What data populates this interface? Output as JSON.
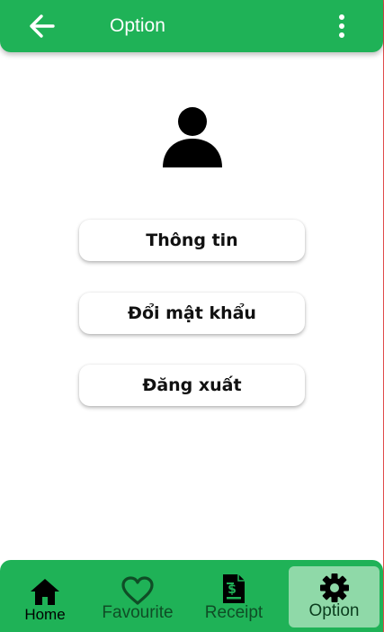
{
  "app_bar": {
    "title": "Option",
    "back_icon": "arrow-left-icon",
    "more_icon": "more-vertical-icon"
  },
  "profile": {
    "avatar_icon": "person-icon"
  },
  "menu": {
    "items": [
      {
        "label": "Thông tin"
      },
      {
        "label": "Đổi mật khẩu"
      },
      {
        "label": "Đăng xuất"
      }
    ]
  },
  "bottom_nav": {
    "items": [
      {
        "label": "Home",
        "icon": "home-icon"
      },
      {
        "label": "Favourite",
        "icon": "heart-icon"
      },
      {
        "label": "Receipt",
        "icon": "receipt-icon"
      },
      {
        "label": "Option",
        "icon": "gear-icon",
        "active": true
      }
    ]
  },
  "colors": {
    "primary": "#1fb257",
    "active_tab": "#8fd9a8"
  }
}
